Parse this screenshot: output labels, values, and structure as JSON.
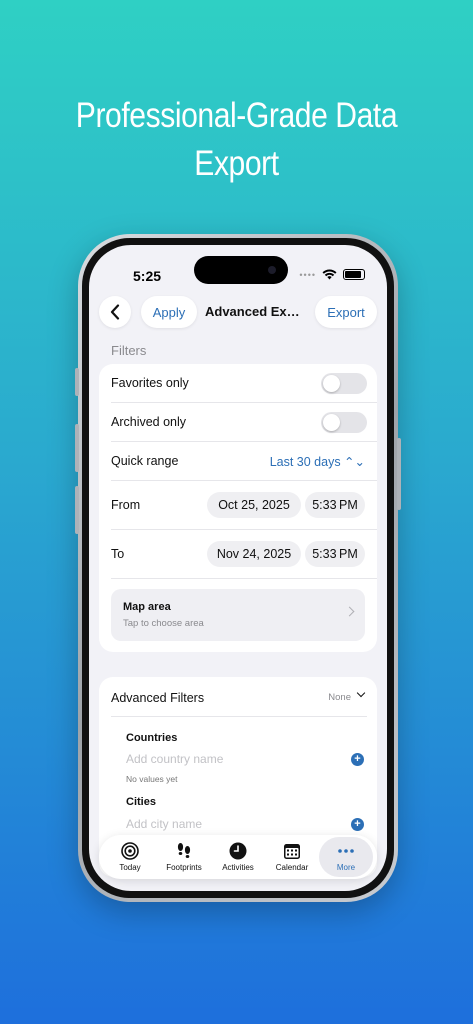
{
  "headline": {
    "line1": "Professional-Grade Data",
    "line2": "Export"
  },
  "status_bar": {
    "time": "5:25"
  },
  "navbar": {
    "apply_label": "Apply",
    "title": "Advanced Exp...",
    "export_label": "Export"
  },
  "filters": {
    "section_title": "Filters",
    "favorites_label": "Favorites only",
    "favorites_on": false,
    "archived_label": "Archived only",
    "archived_on": false,
    "quick_range_label": "Quick range",
    "quick_range_value": "Last 30 days ⌃⌄",
    "from_label": "From",
    "from_date": "Oct 25, 2025",
    "from_time": "5:33 PM",
    "to_label": "To",
    "to_date": "Nov 24, 2025",
    "to_time": "5:33 PM",
    "map_title": "Map area",
    "map_subtitle": "Tap to choose area"
  },
  "advanced": {
    "title": "Advanced Filters",
    "state": "None",
    "countries_title": "Countries",
    "countries_placeholder": "Add country name",
    "countries_note": "No values yet",
    "cities_title": "Cities",
    "cities_placeholder": "Add city name"
  },
  "tabbar": {
    "items": [
      {
        "label": "Today",
        "icon": "target-icon"
      },
      {
        "label": "Footprints",
        "icon": "footprints-icon"
      },
      {
        "label": "Activities",
        "icon": "clock-icon"
      },
      {
        "label": "Calendar",
        "icon": "calendar-icon"
      },
      {
        "label": "More",
        "icon": "more-dots-icon"
      }
    ],
    "active": "More"
  },
  "colors": {
    "accent": "#2c6fb6",
    "background_top": "#2fd0c4",
    "background_bottom": "#1e6fdc"
  }
}
